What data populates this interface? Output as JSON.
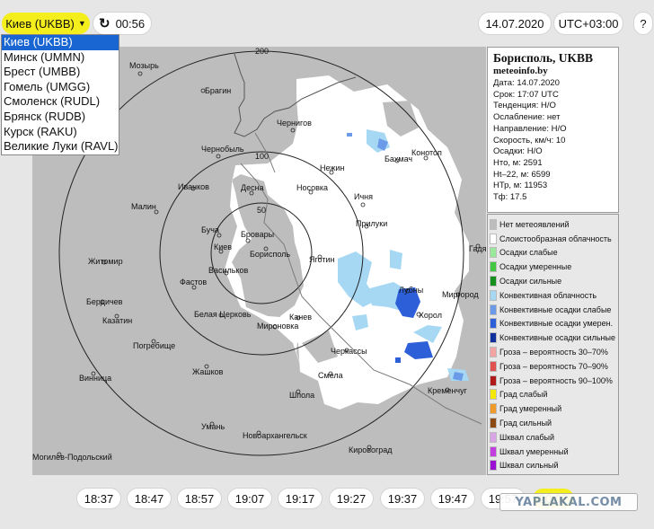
{
  "toolbar": {
    "station": "Киев (UKBB)",
    "refresh_label": "00:56",
    "date": "14.07.2020",
    "timezone": "UTC+03:00",
    "help": "?"
  },
  "dropdown": {
    "options": [
      "Киев (UKBB)",
      "Минск (UMMN)",
      "Брест (UMBB)",
      "Гомель (UMGG)",
      "Смоленск (RUDL)",
      "Брянск (RUDB)",
      "Курск (RAKU)",
      "Великие Луки (RAVL)"
    ],
    "selected": "Киев (UKBB)"
  },
  "map": {
    "rings": [
      "200",
      "100",
      "50"
    ],
    "cities": [
      "Мозырь",
      "Брагин",
      "Чернигов",
      "Чернобыль",
      "Нежин",
      "Бахмач",
      "Конотоп",
      "Иванков",
      "Десна",
      "Носовка",
      "Ичня",
      "Малин",
      "Буча",
      "Бровары",
      "Киев",
      "Прилуки",
      "Житомир",
      "Борисполь",
      "Яготин",
      "Гадяч",
      "Васильков",
      "Фастов",
      "Лубны",
      "Миргород",
      "Хорол",
      "Бердичев",
      "Белая Церковь",
      "Мироновка",
      "Канев",
      "Казатин",
      "Погребище",
      "Черкассы",
      "Жашков",
      "Смела",
      "Винница",
      "Шпола",
      "Кременчуг",
      "Умань",
      "Новоархангельск",
      "Могилев-Подольский",
      "Кировоград"
    ]
  },
  "info": {
    "title": "Борисполь, UKBB",
    "site": "meteoinfo.by",
    "lines": [
      "Дата: 14.07.2020",
      "Срок: 17:07 UTC",
      "Тенденция: Н/О",
      "Ослабление: нет",
      "Направление: Н/О",
      "Скорость, км/ч: 10",
      "Осадки: Н/О",
      "Hто, м: 2591",
      "Ht–22, м: 6599",
      "НТр, м: 11953",
      "Тф: 17.5"
    ]
  },
  "legend": {
    "items": [
      {
        "label": "Нет метеоявлений",
        "color": "#bdbdbd"
      },
      {
        "label": "Слоистообразная облачность",
        "color": "#ffffff"
      },
      {
        "label": "Осадки слабые",
        "color": "#9ae89a"
      },
      {
        "label": "Осадки умеренные",
        "color": "#44c844"
      },
      {
        "label": "Осадки сильные",
        "color": "#15901e"
      },
      {
        "label": "Конвективная облачность",
        "color": "#a6d8f4"
      },
      {
        "label": "Конвективные осадки слабые",
        "color": "#6b9be8"
      },
      {
        "label": "Конвективные осадки умерен.",
        "color": "#2d5fd9"
      },
      {
        "label": "Конвективные осадки сильные",
        "color": "#102f9a"
      },
      {
        "label": "Гроза – вероятность 30–70%",
        "color": "#f2a4a4"
      },
      {
        "label": "Гроза – вероятность 70–90%",
        "color": "#e05050"
      },
      {
        "label": "Гроза – вероятность 90–100%",
        "color": "#b01a1a"
      },
      {
        "label": "Град слабый",
        "color": "#f5e800"
      },
      {
        "label": "Град умеренный",
        "color": "#f09a2a"
      },
      {
        "label": "Град сильный",
        "color": "#8a4a12"
      },
      {
        "label": "Шквал слабый",
        "color": "#d8a6e6"
      },
      {
        "label": "Шквал умеренный",
        "color": "#c23ee0"
      },
      {
        "label": "Шквал сильный",
        "color": "#9a10d2"
      }
    ]
  },
  "timeline": {
    "times": [
      "18:37",
      "18:47",
      "18:57",
      "19:07",
      "19:17",
      "19:27",
      "19:37",
      "19:47",
      "19:57",
      "20:07"
    ],
    "active": "20:07"
  },
  "watermark": "YAPLAKAL.COM"
}
